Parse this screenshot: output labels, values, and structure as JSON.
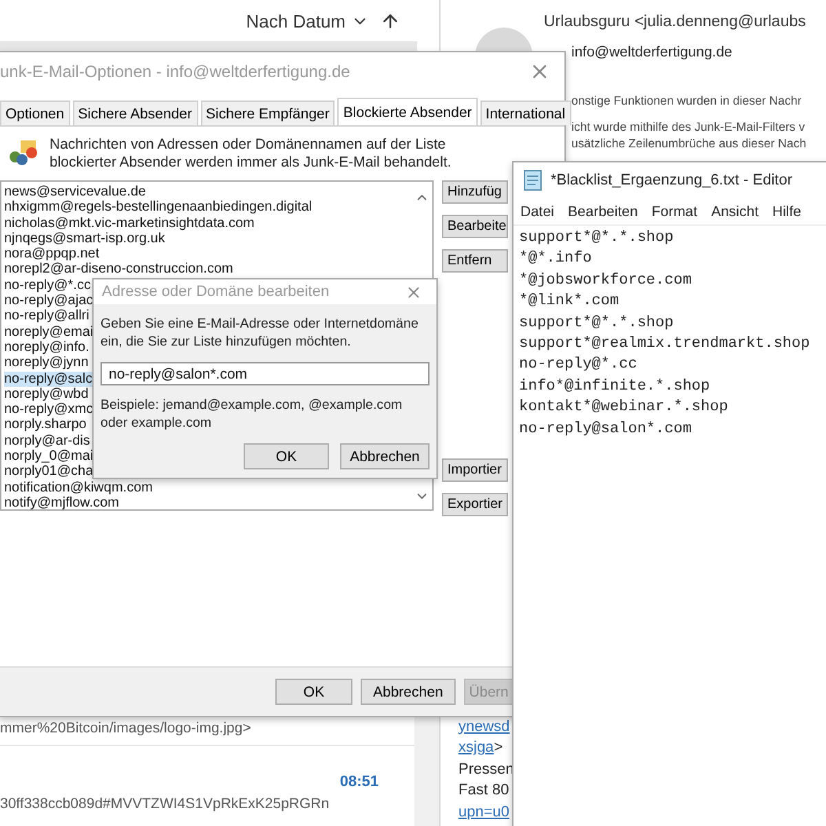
{
  "message_list": {
    "sort_label": "Nach Datum",
    "messages": [
      {
        "preview": "mmer%20Bitcoin/images/logo-img.jpg>"
      },
      {
        "time": "08:51",
        "preview": "30ff338ccb089d#MVVTZWI4S1VpRkExK25pRGRn"
      }
    ]
  },
  "reading_pane": {
    "sender": "Urlaubsguru <julia.denneng@urlaubs",
    "to": "info@weltderfertigung.de",
    "info_lines": [
      "onstige Funktionen wurden in dieser Nachr",
      "icht wurde mithilfe des Junk-E-Mail-Filters v",
      "usätzliche Zeilenumbrüche aus dieser Nach"
    ],
    "body_lines": [
      [
        {
          "text": "ynewsd",
          "link": true
        }
      ],
      [
        {
          "text": "xsjga",
          "link": true
        },
        {
          "text": ">",
          "link": false
        }
      ],
      [
        {
          "text": "Pressen",
          "link": false
        }
      ],
      [
        {
          "text": "Fast 80",
          "link": false
        }
      ],
      [
        {
          "text": "upn=u0",
          "link": true
        }
      ]
    ]
  },
  "junk_dialog": {
    "title": "unk-E-Mail-Optionen - info@weltderfertigung.de",
    "tabs": [
      {
        "label": "Optionen",
        "selected": false
      },
      {
        "label": "Sichere Absender",
        "selected": false
      },
      {
        "label": "Sichere Empfänger",
        "selected": false
      },
      {
        "label": "Blockierte Absender",
        "selected": true
      },
      {
        "label": "International",
        "selected": false
      }
    ],
    "description": "Nachrichten von Adressen oder Domänennamen auf der Liste blockierter Absender werden immer als Junk-E-Mail behandelt.",
    "blocked_senders": [
      {
        "address": "news@servicevalue.de",
        "selected": false
      },
      {
        "address": "nhxigmm@regels-bestellingenaanbiedingen.digital",
        "selected": false
      },
      {
        "address": "nicholas@mkt.vic-marketinsightdata.com",
        "selected": false
      },
      {
        "address": "njnqegs@smart-isp.org.uk",
        "selected": false
      },
      {
        "address": "nora@ppqp.net",
        "selected": false
      },
      {
        "address": "norepl2@ar-diseno-construccion.com",
        "selected": false
      },
      {
        "address": "no-reply@*.cc",
        "selected": false
      },
      {
        "address": "no-reply@ajac",
        "selected": false
      },
      {
        "address": "no-reply@allri",
        "selected": false
      },
      {
        "address": "noreply@emai",
        "selected": false
      },
      {
        "address": "noreply@info.",
        "selected": false
      },
      {
        "address": "noreply@jynn",
        "selected": false
      },
      {
        "address": "no-reply@salc",
        "selected": true
      },
      {
        "address": "noreply@wbd",
        "selected": false
      },
      {
        "address": "no-reply@xmc",
        "selected": false
      },
      {
        "address": "norply.sharpo",
        "selected": false
      },
      {
        "address": "norply@ar-dis",
        "selected": false
      },
      {
        "address": "norply_0@mai",
        "selected": false
      },
      {
        "address": "norply01@cha",
        "selected": false
      },
      {
        "address": "notification@kiwqm.com",
        "selected": false
      },
      {
        "address": "notify@mjflow.com",
        "selected": false
      }
    ],
    "side_buttons": {
      "top": [
        "Hinzufüg",
        "Bearbeite",
        "Entfern"
      ],
      "bottom": [
        "Importier",
        "Exportier"
      ]
    },
    "footer_buttons": [
      {
        "label": "OK",
        "disabled": false
      },
      {
        "label": "Abbrechen",
        "disabled": false
      },
      {
        "label": "Übern",
        "disabled": true
      }
    ]
  },
  "edit_dialog": {
    "title": "Adresse oder Domäne bearbeiten",
    "prompt": "Geben Sie eine E-Mail-Adresse oder Internetdomäne ein, die Sie zur Liste hinzufügen möchten.",
    "value": "no-reply@salon*.com",
    "examples": "Beispiele: jemand@example.com, @example.com oder example.com",
    "buttons": [
      "OK",
      "Abbrechen"
    ]
  },
  "editor": {
    "title": "*Blacklist_Ergaenzung_6.txt - Editor",
    "menu": [
      "Datei",
      "Bearbeiten",
      "Format",
      "Ansicht",
      "Hilfe"
    ],
    "lines": [
      "support*@*.*.shop",
      "*@*.info",
      "*@jobsworkforce.com",
      "*@link*.com",
      "support*@*.*.shop",
      "support*@realmix.trendmarkt.shop",
      "no-reply@*.cc",
      "info*@infinite.*.shop",
      "kontakt*@webinar.*.shop",
      "no-reply@salon*.com"
    ]
  }
}
